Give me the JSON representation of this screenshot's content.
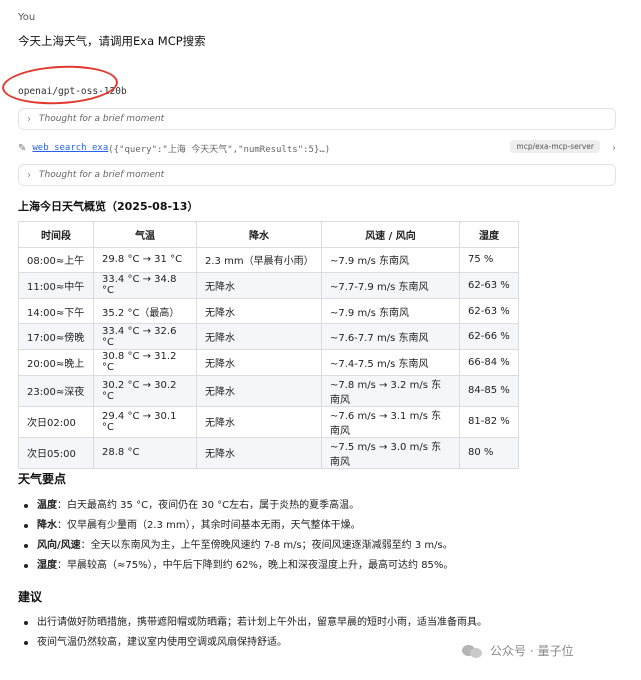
{
  "chat": {
    "user_label": "You",
    "user_message": "今天上海天气，请调用Exa MCP搜索",
    "model_name": "openai/gpt-oss-120b",
    "thought_1": "Thought for a brief moment",
    "thought_2": "Thought for a brief moment",
    "tool_call": {
      "name": "web_search_exa",
      "args": "({\"query\":\"上海 今天天气\",\"numResults\":5}…)",
      "server_tag": "mcp/exa-mcp-server"
    }
  },
  "report": {
    "title": "上海今日天气概览（2025-08-13）",
    "table": {
      "headers": [
        "时间段",
        "气温",
        "降水",
        "风速 / 风向",
        "湿度"
      ],
      "rows": [
        [
          "08:00≈上午",
          "29.8 °C → 31 °C",
          "2.3 mm（早晨有小雨）",
          "~7.9 m/s 东南风",
          "75 %"
        ],
        [
          "11:00≈中午",
          "33.4 °C → 34.8 °C",
          "无降水",
          "~7.7‑7.9 m/s 东南风",
          "62‑63 %"
        ],
        [
          "14:00≈下午",
          "35.2 °C（最高）",
          "无降水",
          "~7.9 m/s 东南风",
          "62‑63 %"
        ],
        [
          "17:00≈傍晚",
          "33.4 °C → 32.6 °C",
          "无降水",
          "~7.6‑7.7 m/s 东南风",
          "62‑66 %"
        ],
        [
          "20:00≈晚上",
          "30.8 °C → 31.2 °C",
          "无降水",
          "~7.4‑7.5 m/s 东南风",
          "66‑84 %"
        ],
        [
          "23:00≈深夜",
          "30.2 °C → 30.2 °C",
          "无降水",
          "~7.8 m/s → 3.2 m/s 东南风",
          "84‑85 %"
        ],
        [
          "次日02:00",
          "29.4 °C → 30.1 °C",
          "无降水",
          "~7.6 m/s → 3.1 m/s 东南风",
          "81‑82 %"
        ],
        [
          "次日05:00",
          "28.8 °C",
          "无降水",
          "~7.5 m/s → 3.0 m/s 东南风",
          "80 %"
        ]
      ]
    },
    "key_points": {
      "heading": "天气要点",
      "items": [
        {
          "label": "温度",
          "text": "：白天最高约 35 °C，夜间仍在 30 °C左右，属于炎热的夏季高温。"
        },
        {
          "label": "降水",
          "text": "：仅早晨有少量雨（2.3 mm），其余时间基本无雨，天气整体干燥。"
        },
        {
          "label": "风向/风速",
          "text": "：全天以东南风为主，上午至傍晚风速约 7‑8 m/s；夜间风速逐渐减弱至约 3 m/s。"
        },
        {
          "label": "湿度",
          "text": "：早晨较高（≈75%），中午后下降到约 62%，晚上和深夜湿度上升，最高可达约 85%。"
        }
      ]
    },
    "advice": {
      "heading": "建议",
      "items": [
        "出行请做好防晒措施，携带遮阳帽或防晒霜；若计划上午外出，留意早晨的短时小雨，适当准备雨具。",
        "夜间气温仍然较高，建议室内使用空调或风扇保持舒适。"
      ]
    }
  },
  "watermark": {
    "text": "公众号 · 量子位",
    "icon": "wechat-icon"
  },
  "icons": {
    "thought_toggle": "chevron-right-icon",
    "tool": "wrench-icon"
  },
  "colors": {
    "highlight_ellipse": "#e23a2e",
    "link": "#2563eb",
    "row_alt": "#f4f6fa"
  }
}
